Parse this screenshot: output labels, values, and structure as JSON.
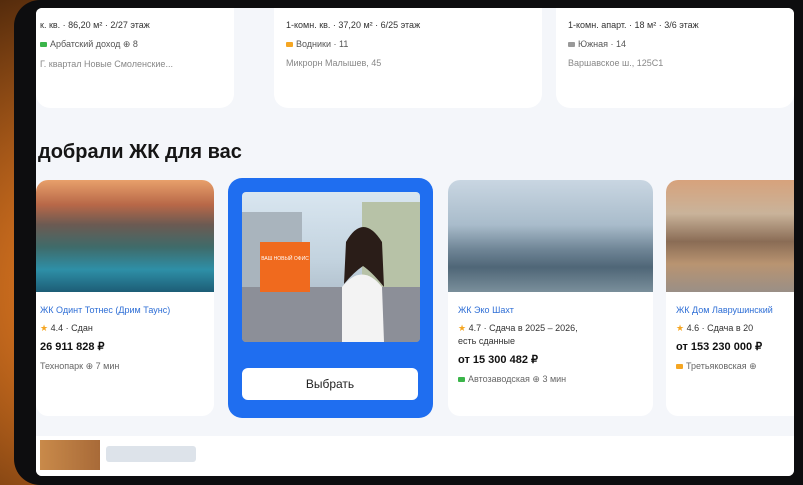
{
  "listings": [
    {
      "line1": "к. кв. · 86,20 м² · 2/27 этаж",
      "line2": "Арбатский доход ⊕ 8",
      "line3": "Г. квартал Новые Смоленские..."
    },
    {
      "line1": "1-комн. кв. · 37,20 м² · 6/25 этаж",
      "line2": "Водники · 11",
      "line3": "Микрорн Малышев, 45"
    },
    {
      "line1": "1-комн. апарт. · 18 м² · 3/6 этаж",
      "line2": "Южная · 14",
      "line3": "Варшавское ш., 125С1"
    }
  ],
  "section_title": "добрали ЖК для вас",
  "complexes": [
    {
      "name": "ЖК Одинт Тотнес (Дрим Таунс)",
      "rating": "4.4 · Сдан",
      "price": "26 911 828 ₽",
      "metro": "Технопарк ⊕ 7 мин"
    },
    {
      "name": "ЖК Эко Шахт",
      "rating": "4.7 · Сдача в 2025 – 2026,",
      "rating2": "есть сданные",
      "price": "от 15 300 482 ₽",
      "metro": "Автозаводская ⊕ 3 мин"
    },
    {
      "name": "ЖК Дом Лаврушинский",
      "rating": "4.6 · Сдача в 20",
      "price": "от 153 230 000 ₽",
      "metro": "Третьяковская ⊕"
    }
  ],
  "promo": {
    "badge": "ВАШ НОВЫЙ ОФИС",
    "button_label": "Выбрать"
  },
  "colors": {
    "accent": "#1f6ef0",
    "link": "#2f6fd6",
    "star": "#f5a623"
  }
}
